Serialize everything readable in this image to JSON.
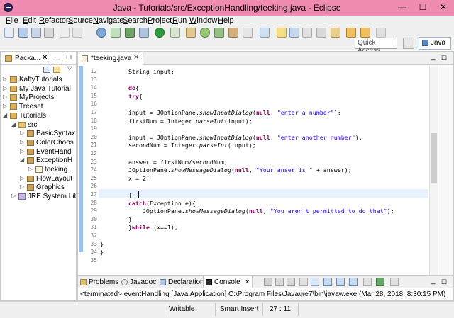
{
  "window": {
    "title": "Java - Tutorials/src/ExceptionHandling/teeking.java - Eclipse",
    "minimize": "—",
    "maximize": "☐",
    "close": "✕"
  },
  "menu": [
    "File",
    "Edit",
    "Refactor",
    "Source",
    "Navigate",
    "Search",
    "Project",
    "Run",
    "Window",
    "Help"
  ],
  "toolbar": {
    "quick_access_placeholder": "Quick Access",
    "perspective": "Java"
  },
  "package_explorer": {
    "tab_label": "Packa...",
    "items": [
      {
        "label": "KaffyTutorials",
        "depth": 0,
        "arrow": "▷",
        "icon": "project-icon"
      },
      {
        "label": "My Java Tutorial",
        "depth": 0,
        "arrow": "▷",
        "icon": "project-icon"
      },
      {
        "label": "MyProjects",
        "depth": 0,
        "arrow": "▷",
        "icon": "project-icon"
      },
      {
        "label": "Treeset",
        "depth": 0,
        "arrow": "▷",
        "icon": "project-icon"
      },
      {
        "label": "Tutorials",
        "depth": 0,
        "arrow": "◢",
        "icon": "project-icon"
      },
      {
        "label": "src",
        "depth": 1,
        "arrow": "◢",
        "icon": "source-folder-icon"
      },
      {
        "label": "BasicSyntax",
        "depth": 2,
        "arrow": "▷",
        "icon": "package-icon"
      },
      {
        "label": "ColorChoos",
        "depth": 2,
        "arrow": "▷",
        "icon": "package-icon"
      },
      {
        "label": "EventHandl",
        "depth": 2,
        "arrow": "▷",
        "icon": "package-icon"
      },
      {
        "label": "ExceptionH",
        "depth": 2,
        "arrow": "◢",
        "icon": "package-icon"
      },
      {
        "label": "teeking.",
        "depth": 3,
        "arrow": "▷",
        "icon": "java-file-icon"
      },
      {
        "label": "FlowLayout",
        "depth": 2,
        "arrow": "▷",
        "icon": "package-icon"
      },
      {
        "label": "Graphics",
        "depth": 2,
        "arrow": "▷",
        "icon": "package-icon"
      },
      {
        "label": "JRE System Libr",
        "depth": 1,
        "arrow": "▷",
        "icon": "library-icon"
      }
    ]
  },
  "editor": {
    "tab_label": "*teeking.java",
    "line_numbers": [
      "12",
      "13",
      "14",
      "15",
      "16",
      "17",
      "18",
      "19",
      "20",
      "21",
      "22",
      "23",
      "24",
      "25",
      "26",
      "27",
      "28",
      "29",
      "30",
      "31",
      "32",
      "33",
      "34",
      "35"
    ],
    "lines": [
      [
        {
          "t": "        String input;"
        }
      ],
      [
        {
          "t": ""
        }
      ],
      [
        {
          "t": "        "
        },
        {
          "t": "do",
          "c": "kw"
        },
        {
          "t": "{"
        }
      ],
      [
        {
          "t": "        "
        },
        {
          "t": "try",
          "c": "kw"
        },
        {
          "t": "{"
        }
      ],
      [
        {
          "t": ""
        }
      ],
      [
        {
          "t": "        input = JOptionPane."
        },
        {
          "t": "showInputDialog",
          "c": "it"
        },
        {
          "t": "("
        },
        {
          "t": "null",
          "c": "kw"
        },
        {
          "t": ", "
        },
        {
          "t": "\"enter a number\"",
          "c": "str"
        },
        {
          "t": ");"
        }
      ],
      [
        {
          "t": "        firstNum = Integer."
        },
        {
          "t": "parseInt",
          "c": "it"
        },
        {
          "t": "(input);"
        }
      ],
      [
        {
          "t": ""
        }
      ],
      [
        {
          "t": "        input = JOptionPane."
        },
        {
          "t": "showInputDialog",
          "c": "it"
        },
        {
          "t": "("
        },
        {
          "t": "null",
          "c": "kw"
        },
        {
          "t": ", "
        },
        {
          "t": "\"enter another number\"",
          "c": "str"
        },
        {
          "t": ");"
        }
      ],
      [
        {
          "t": "        secondNum = Integer."
        },
        {
          "t": "parseInt",
          "c": "it"
        },
        {
          "t": "(input);"
        }
      ],
      [
        {
          "t": ""
        }
      ],
      [
        {
          "t": "        answer = firstNum/secondNum;"
        }
      ],
      [
        {
          "t": "        JOptionPane."
        },
        {
          "t": "showMessageDialog",
          "c": "it"
        },
        {
          "t": "("
        },
        {
          "t": "null",
          "c": "kw"
        },
        {
          "t": ", "
        },
        {
          "t": "\"Your anser is \"",
          "c": "str"
        },
        {
          "t": " + answer);"
        }
      ],
      [
        {
          "t": "        x = 2;"
        }
      ],
      [
        {
          "t": ""
        }
      ],
      [
        {
          "t": "        }"
        }
      ],
      [
        {
          "t": "        "
        },
        {
          "t": "catch",
          "c": "kw"
        },
        {
          "t": "(Exception e){"
        }
      ],
      [
        {
          "t": "            JOptionPane."
        },
        {
          "t": "showMessageDialog",
          "c": "it"
        },
        {
          "t": "("
        },
        {
          "t": "null",
          "c": "kw"
        },
        {
          "t": ", "
        },
        {
          "t": "\"You aren't permitted to do that\"",
          "c": "str"
        },
        {
          "t": ");"
        }
      ],
      [
        {
          "t": "        }"
        }
      ],
      [
        {
          "t": "        }"
        },
        {
          "t": "while",
          "c": "kw"
        },
        {
          "t": " (x==1);"
        }
      ],
      [
        {
          "t": ""
        }
      ],
      [
        {
          "t": "}"
        }
      ],
      [
        {
          "t": "}"
        }
      ],
      [
        {
          "t": ""
        }
      ]
    ]
  },
  "bottom_panel": {
    "tabs": [
      {
        "label": "Problems",
        "icon": "problems-icon",
        "name": "tab-problems"
      },
      {
        "label": "Javadoc",
        "icon": "javadoc-icon",
        "name": "tab-javadoc"
      },
      {
        "label": "Declaration",
        "icon": "declaration-icon",
        "name": "tab-declaration"
      },
      {
        "label": "Console",
        "icon": "console-icon",
        "name": "tab-console"
      }
    ],
    "console_text": "<terminated> eventHandling [Java Application] C:\\Program Files\\Java\\jre7\\bin\\javaw.exe (Mar 28, 2018, 8:30:15 PM)"
  },
  "status": {
    "writable": "Writable",
    "insert_mode": "Smart Insert",
    "position": "27 : 11"
  }
}
